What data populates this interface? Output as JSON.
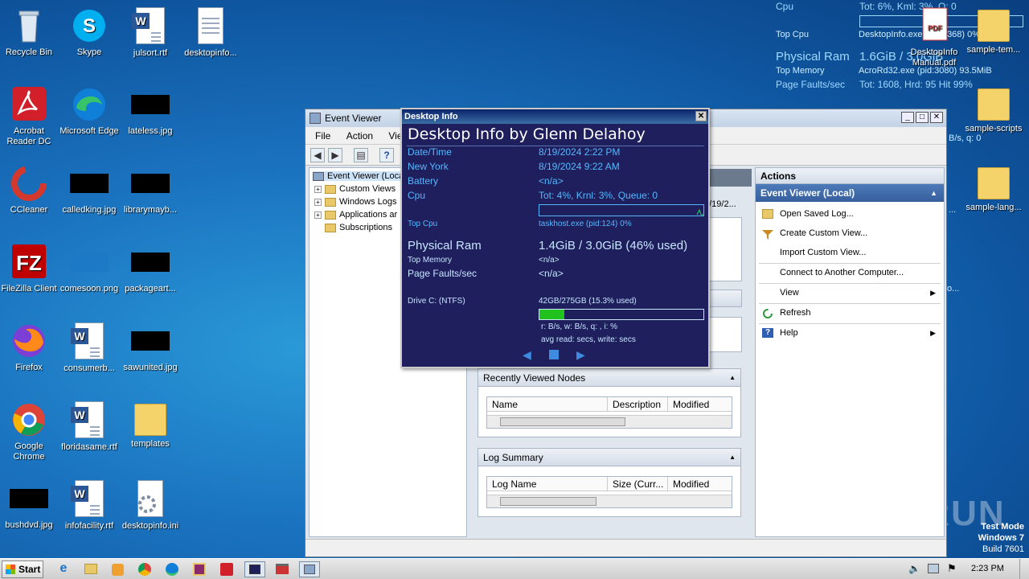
{
  "desktop": {
    "icons": [
      {
        "label": "Recycle Bin",
        "icon": "recycle-bin-icon"
      },
      {
        "label": "Skype",
        "icon": "skype-icon"
      },
      {
        "label": "julsort.rtf",
        "icon": "word-doc-icon"
      },
      {
        "label": "desktopinfo...",
        "icon": "text-file-icon"
      },
      {
        "label": "Acrobat Reader DC",
        "icon": "acrobat-icon"
      },
      {
        "label": "Microsoft Edge",
        "icon": "edge-icon"
      },
      {
        "label": "lateless.jpg",
        "icon": "image-file-icon"
      },
      {
        "label": "CCleaner",
        "icon": "ccleaner-icon"
      },
      {
        "label": "calledking.jpg",
        "icon": "image-file-icon"
      },
      {
        "label": "librarymayb...",
        "icon": "image-file-icon"
      },
      {
        "label": "FileZilla Client",
        "icon": "filezilla-icon"
      },
      {
        "label": "comesoon.png",
        "icon": "image-file-icon"
      },
      {
        "label": "packageart...",
        "icon": "image-file-icon"
      },
      {
        "label": "Firefox",
        "icon": "firefox-icon"
      },
      {
        "label": "consumerb...",
        "icon": "word-doc-icon"
      },
      {
        "label": "sawunited.jpg",
        "icon": "image-file-icon"
      },
      {
        "label": "Google Chrome",
        "icon": "chrome-icon"
      },
      {
        "label": "floridasame.rtf",
        "icon": "word-doc-icon"
      },
      {
        "label": "templates",
        "icon": "folder-icon"
      },
      {
        "label": "bushdvd.jpg",
        "icon": "image-file-icon"
      },
      {
        "label": "infofacility.rtf",
        "icon": "word-doc-icon"
      },
      {
        "label": "desktopinfo.ini",
        "icon": "settings-file-icon"
      }
    ],
    "right_icons": [
      {
        "label": "DesktopInfo Manual.pdf",
        "icon": "pdf-icon"
      },
      {
        "label": "sample-tem...",
        "icon": "folder-icon"
      },
      {
        "label": "sample-scripts",
        "icon": "folder-icon"
      },
      {
        "label": "sample-lang...",
        "icon": "folder-icon"
      }
    ],
    "overlay": {
      "cpu_label": "Cpu",
      "cpu_value": "Tot:  6%, Kml:  3%, Q: 0",
      "top_cpu_label": "Top Cpu",
      "top_cpu_value": "DesktopInfo.exe (pid:3368) 0%",
      "ram_label": "Physical Ram",
      "ram_value": "1.6GiB / 3.0GiB",
      "top_mem_label": "Top Memory",
      "top_mem_value": "AcroRd32.exe (pid:3080) 93.5MiB",
      "pf_label": "Page Faults/sec",
      "pf_value": "Tot: 1608, Hrd: 95 Hit 99%",
      "partial_right": "B/s, q: 0",
      "ellipsis1": "...",
      "ellipsis2": "o..."
    },
    "test_mode": {
      "line1": "Test Mode",
      "line2": "Windows 7",
      "line3": "Build 7601"
    },
    "watermark": "ANY RUN"
  },
  "event_viewer": {
    "title": "Event Viewer",
    "menu": [
      "File",
      "Action",
      "View"
    ],
    "tree": [
      {
        "label": "Event Viewer (Local)",
        "expand": ""
      },
      {
        "label": "Custom Views",
        "expand": "+"
      },
      {
        "label": "Windows Logs",
        "expand": "+"
      },
      {
        "label": "Applications ar",
        "expand": "+"
      },
      {
        "label": "Subscriptions",
        "expand": ""
      }
    ],
    "center_partial": "8/19/2...",
    "recent_panel": {
      "title": "Recently Viewed Nodes",
      "columns": [
        "Name",
        "Description",
        "Modified"
      ]
    },
    "log_panel": {
      "title": "Log Summary",
      "columns": [
        "Log Name",
        "Size (Curr...",
        "Modified"
      ]
    },
    "actions": {
      "header": "Actions",
      "section": "Event Viewer (Local)",
      "items": [
        {
          "label": "Open Saved Log...",
          "icon": "open-folder-icon",
          "submenu": false
        },
        {
          "label": "Create Custom View...",
          "icon": "filter-icon",
          "submenu": false
        },
        {
          "label": "Import Custom View...",
          "icon": "",
          "submenu": false
        },
        {
          "label": "Connect to Another Computer...",
          "icon": "",
          "submenu": false
        },
        {
          "label": "View",
          "icon": "",
          "submenu": true
        },
        {
          "label": "Refresh",
          "icon": "refresh-icon",
          "submenu": false
        },
        {
          "label": "Help",
          "icon": "help-icon",
          "submenu": true
        }
      ]
    }
  },
  "desktop_info": {
    "window_title": "Desktop Info",
    "heading": "Desktop Info by Glenn Delahoy",
    "rows": [
      {
        "label": "Date/Time",
        "value": "8/19/2024 2:22 PM"
      },
      {
        "label": "New York",
        "value": "8/19/2024 9:22 AM"
      },
      {
        "label": "Battery",
        "value": "<n/a>"
      },
      {
        "label": "Cpu",
        "value": "Tot:  4%, Krnl:  3%, Queue: 0"
      }
    ],
    "top_cpu_label": "Top Cpu",
    "top_cpu_value": "taskhost.exe (pid:124) 0%",
    "ram_label": "Physical Ram",
    "ram_value": "1.4GiB / 3.0GiB (46% used)",
    "top_mem_label": "Top Memory",
    "top_mem_value": "<n/a>",
    "pf_label": "Page Faults/sec",
    "pf_value": "<n/a>",
    "drive_label": "Drive C: (NTFS)",
    "drive_value": "42GB/275GB (15.3% used)",
    "drive_used_fraction": 0.153,
    "io_line1": "r: B/s, w: B/s, q: , i: %",
    "io_line2": "avg read: secs, write: secs",
    "colors": {
      "background": "#1e1f5c",
      "text": "#55b8ff",
      "drive_bar": "#22c21e"
    }
  },
  "taskbar": {
    "start_label": "Start",
    "clock": "2:23 PM",
    "apps": [
      "ie-icon",
      "explorer-icon",
      "media-player-icon",
      "chrome-icon",
      "edge-icon",
      "winrar-icon",
      "acrobat-icon",
      "desktopinfo-icon",
      "toolbox-icon",
      "event-viewer-icon"
    ]
  }
}
